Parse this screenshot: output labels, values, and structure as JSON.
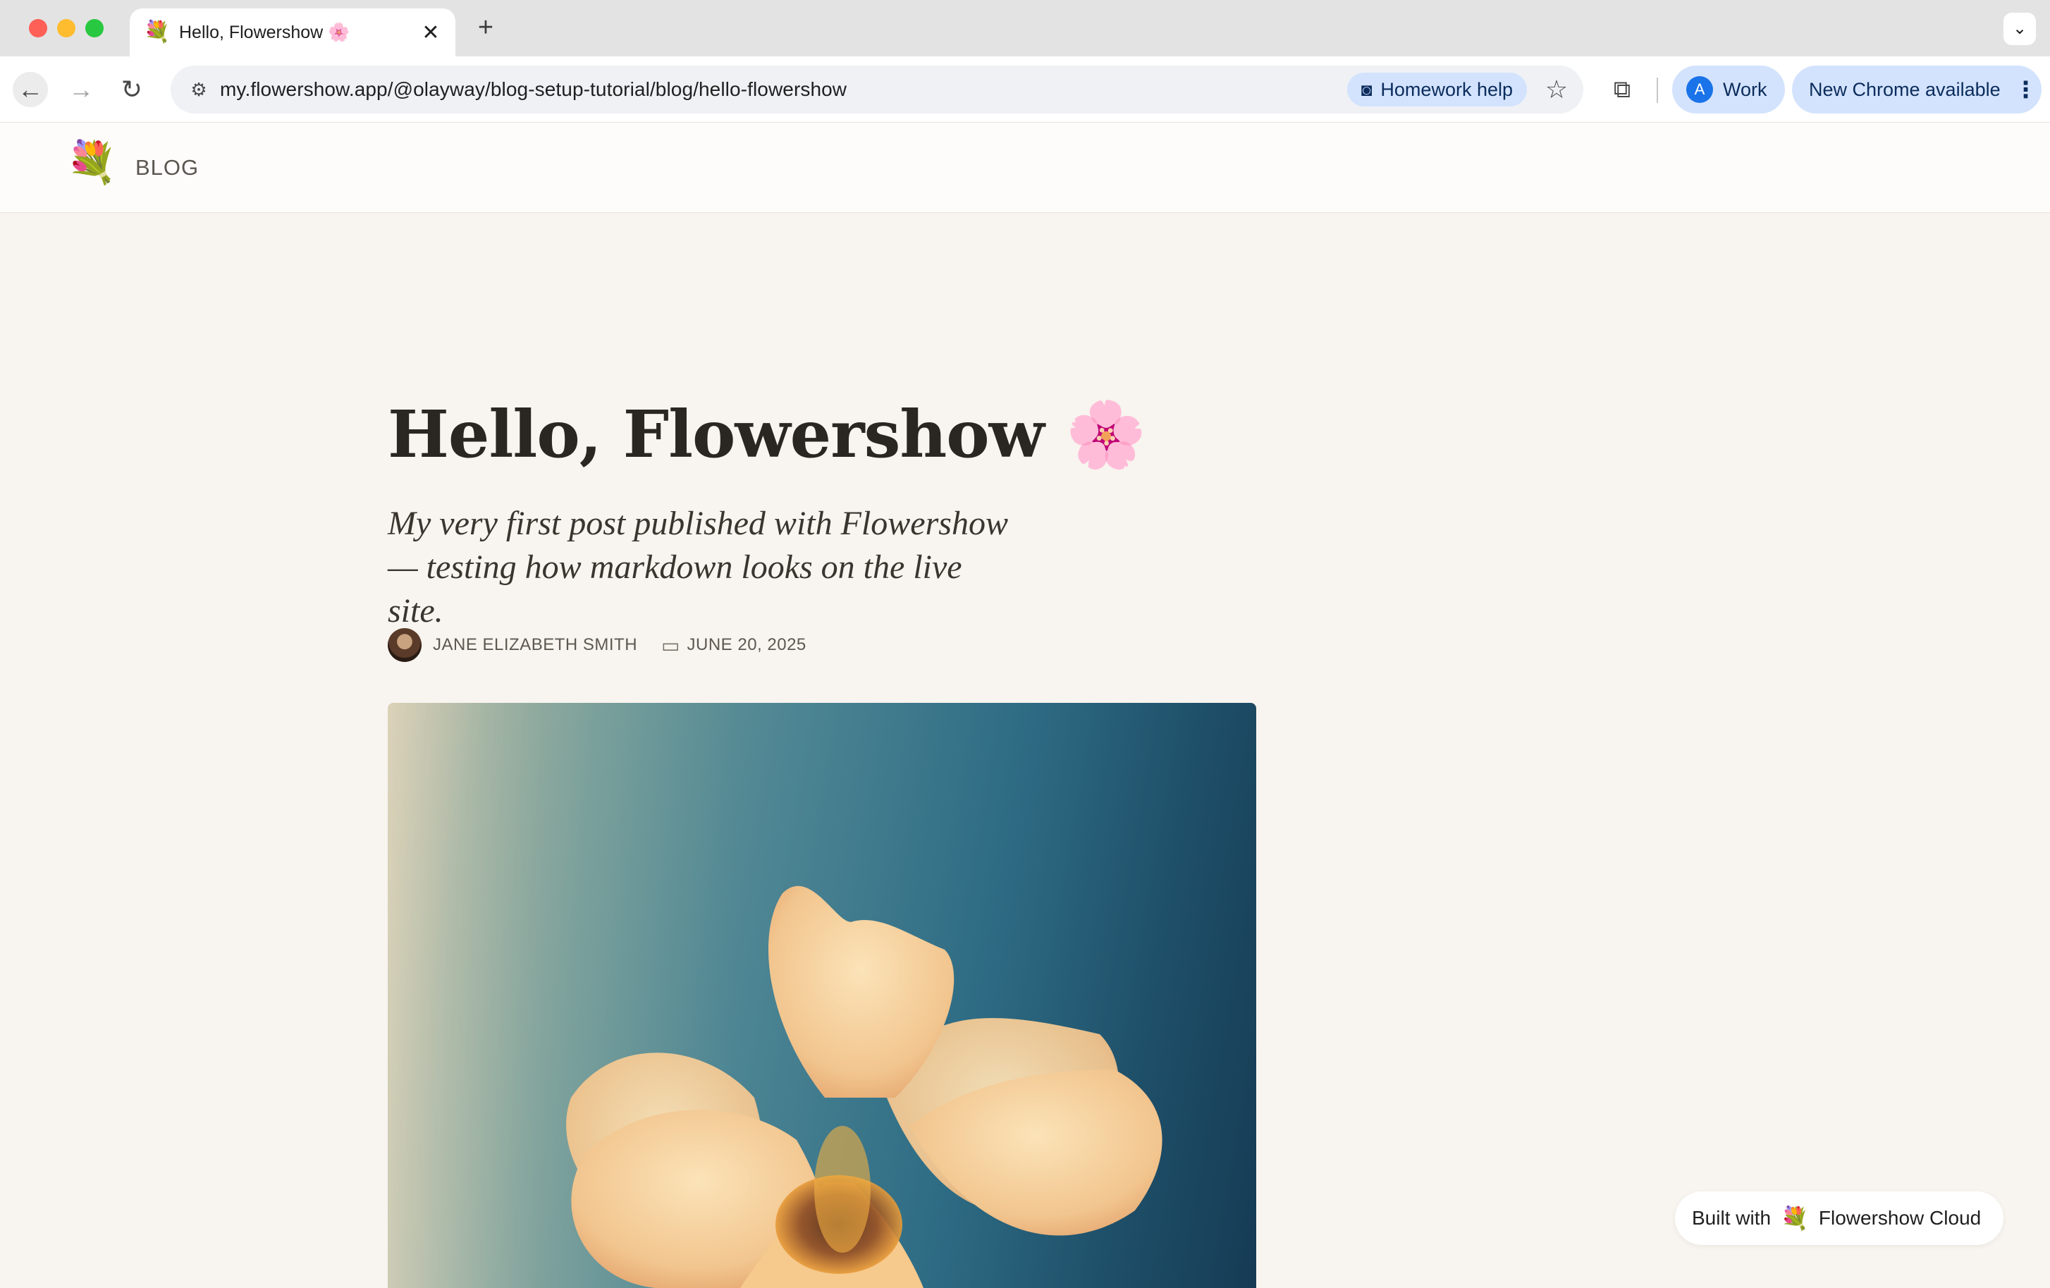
{
  "browser": {
    "tab": {
      "title": "Hello, Flowershow 🌸",
      "favicon": "💐"
    },
    "url": "my.flowershow.app/@olayway/blog-setup-tutorial/blog/hello-flowershow",
    "homework_help": "Homework help",
    "profile": {
      "initial": "A",
      "label": "Work"
    },
    "update_label": "New Chrome available"
  },
  "site": {
    "logo": "💐",
    "nav_blog": "BLOG"
  },
  "post": {
    "title": "Hello, Flowershow 🌸",
    "subtitle": "My very first post published with Flowershow — testing how markdown looks on the live site.",
    "author": "JANE ELIZABETH SMITH",
    "date": "JUNE 20, 2025"
  },
  "badge": {
    "prefix": "Built with",
    "icon": "💐",
    "name": "Flowershow Cloud"
  },
  "colors": {
    "page_bg": "#f8f4ef",
    "chrome_accent": "#d3e3fd",
    "title_text": "#2a2621"
  }
}
